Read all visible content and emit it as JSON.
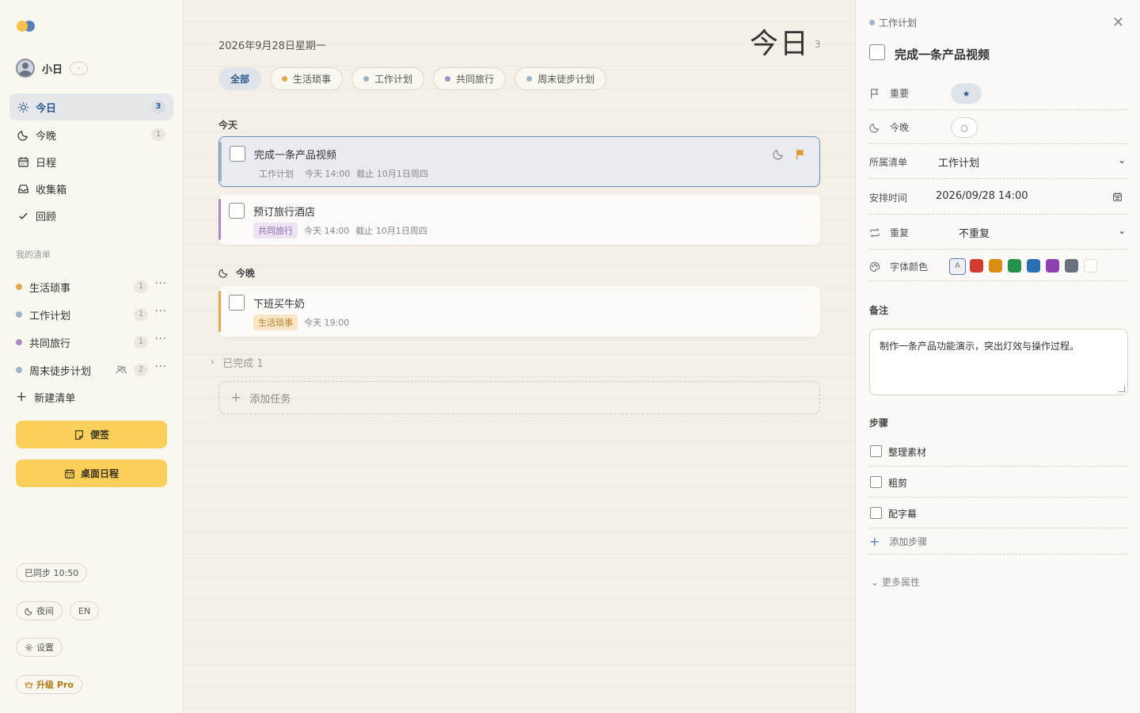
{
  "sidebar": {
    "user": {
      "name": "小日",
      "chip": "-"
    },
    "nav": [
      {
        "label": "今日",
        "count": "3"
      },
      {
        "label": "今晚",
        "count": "1"
      },
      {
        "label": "日程"
      },
      {
        "label": "收集箱"
      },
      {
        "label": "回顾"
      }
    ],
    "lists_label": "我的清单",
    "lists": [
      {
        "label": "生活琐事",
        "count": "1",
        "color": "#e2a84a"
      },
      {
        "label": "工作计划",
        "count": "1",
        "color": "#9fb2c6"
      },
      {
        "label": "共同旅行",
        "count": "1",
        "color": "#a98bc7"
      },
      {
        "label": "周末徒步计划",
        "count": "2",
        "color": "#9fb2c6"
      }
    ],
    "new_list": "新建清单",
    "sticky_btn": "便签",
    "desktop_btn": "桌面日程",
    "sync": "已同步 10:50",
    "night": "夜间",
    "lang": "EN",
    "settings": "设置",
    "upgrade": "升级 Pro"
  },
  "main": {
    "date": "2026年9月28日星期一",
    "title": "今日",
    "title_count": "3",
    "filters": [
      {
        "label": "全部"
      },
      {
        "label": "生活琐事",
        "color": "#e2a84a"
      },
      {
        "label": "工作计划",
        "color": "#9fb2c6"
      },
      {
        "label": "共同旅行",
        "color": "#a98bc7"
      },
      {
        "label": "周末徒步计划",
        "color": "#9fb2c6"
      }
    ],
    "group_today": "今天",
    "group_tonight": "今晚",
    "tasks": [
      {
        "title": "完成一条产品视频",
        "tag": "工作计划",
        "time": "今天 14:00",
        "due": "截止 10月1日周四"
      },
      {
        "title": "预订旅行酒店",
        "tag": "共同旅行",
        "time": "今天 14:00",
        "due": "截止 10月1日周四"
      },
      {
        "title": "下班买牛奶",
        "tag": "生活琐事",
        "time": "今天 19:00"
      }
    ],
    "completed": "已完成 1",
    "add_task": "添加任务"
  },
  "detail": {
    "list": "工作计划",
    "title": "完成一条产品视频",
    "important_label": "重要",
    "important_value": "★",
    "tonight_label": "今晚",
    "tonight_value": "○",
    "list_label": "所属清单",
    "list_value": "工作计划",
    "schedule_label": "安排时间",
    "schedule_value": "2026/09/28 14:00",
    "repeat_label": "重复",
    "repeat_value": "不重复",
    "color_label": "字体颜色",
    "color_auto": "A",
    "colors": [
      "#d23b30",
      "#d98e12",
      "#26904d",
      "#2b70b6",
      "#8e3fb0",
      "#68717e",
      "#ffffff"
    ],
    "note_label": "备注",
    "note": "制作一条产品功能演示，突出灯效与操作过程。",
    "steps_label": "步骤",
    "steps": [
      "整理素材",
      "粗剪",
      "配字幕"
    ],
    "add_step": "添加步骤",
    "more": "更多属性"
  }
}
